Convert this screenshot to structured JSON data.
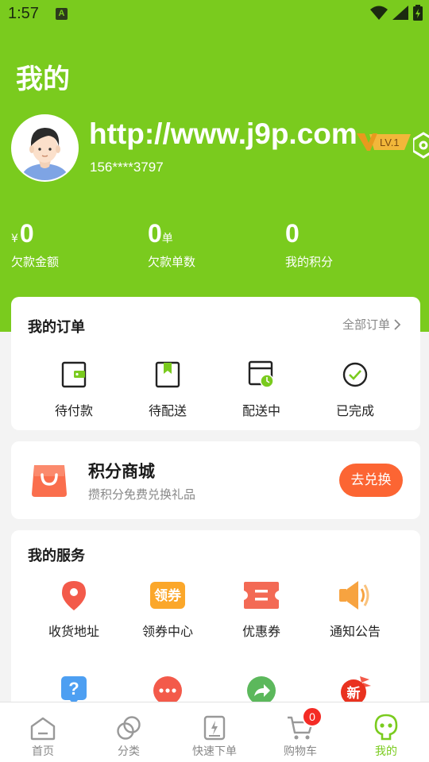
{
  "status_bar": {
    "time": "1:57",
    "notification": "A"
  },
  "page_title": "我的",
  "profile": {
    "username": "http://www.j9p.com",
    "phone": "156****3797",
    "level": "LV.1"
  },
  "stats": [
    {
      "prefix": "¥",
      "value": "0",
      "unit": "",
      "label": "欠款金额"
    },
    {
      "prefix": "",
      "value": "0",
      "unit": "单",
      "label": "欠款单数"
    },
    {
      "prefix": "",
      "value": "0",
      "unit": "",
      "label": "我的积分"
    }
  ],
  "orders": {
    "title": "我的订单",
    "all_label": "全部订单",
    "items": [
      {
        "label": "待付款",
        "icon": "wallet-icon"
      },
      {
        "label": "待配送",
        "icon": "bookmark-box-icon"
      },
      {
        "label": "配送中",
        "icon": "delivery-clock-icon"
      },
      {
        "label": "已完成",
        "icon": "check-circle-icon"
      }
    ]
  },
  "mall": {
    "title": "积分商城",
    "subtitle": "攒积分免费兑换礼品",
    "button": "去兑换"
  },
  "services": {
    "title": "我的服务",
    "items": [
      {
        "label": "收货地址",
        "icon": "location-pin-icon"
      },
      {
        "label": "领券中心",
        "icon": "coupon-center-icon",
        "icon_text": "领券"
      },
      {
        "label": "优惠券",
        "icon": "coupon-icon"
      },
      {
        "label": "通知公告",
        "icon": "speaker-icon"
      }
    ],
    "items_row2": [
      {
        "icon": "help-icon",
        "icon_text": "?"
      },
      {
        "icon": "more-icon"
      },
      {
        "icon": "share-icon"
      },
      {
        "icon": "new-icon",
        "icon_text": "新"
      }
    ]
  },
  "nav": {
    "items": [
      {
        "label": "首页",
        "icon": "home-icon"
      },
      {
        "label": "分类",
        "icon": "category-icon"
      },
      {
        "label": "快速下单",
        "icon": "quick-order-icon"
      },
      {
        "label": "购物车",
        "icon": "cart-icon",
        "badge": "0"
      },
      {
        "label": "我的",
        "icon": "profile-icon",
        "active": true
      }
    ]
  },
  "colors": {
    "brand_green": "#7acb1e",
    "accent_orange": "#fc6533",
    "badge_red": "#f42b25"
  }
}
